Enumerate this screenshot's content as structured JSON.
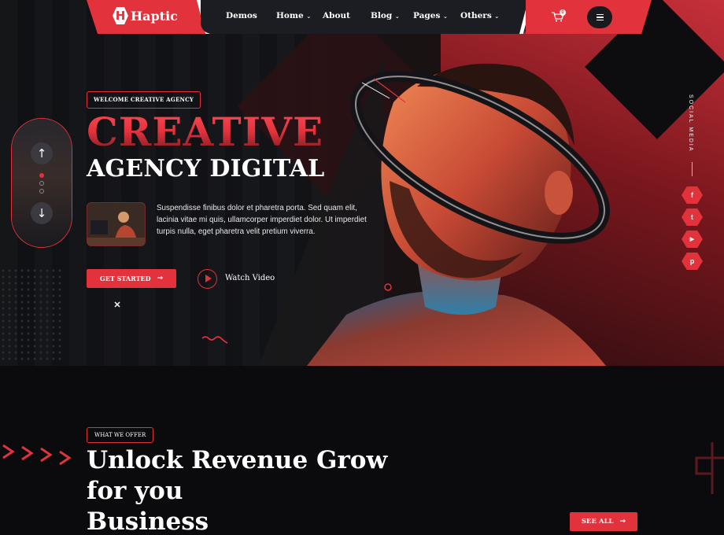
{
  "brand": {
    "name": "Haptic",
    "mark": "H",
    "accent": "#e2323c"
  },
  "nav": {
    "items": [
      {
        "label": "Demos"
      },
      {
        "label": "Home"
      },
      {
        "label": "About"
      },
      {
        "label": "Blog"
      },
      {
        "label": "Pages"
      },
      {
        "label": "Others"
      }
    ],
    "cart_count": "0"
  },
  "hero": {
    "badge": "WELCOME CREATIVE AGENCY",
    "title_1": "CREATIVE",
    "title_2": "AGENCY DIGITAL",
    "paragraph": "Suspendisse finibus dolor et pharetra porta. Sed quam elit, lacinia vitae mi quis, ullamcorper imperdiet dolor. Ut imperdiet turpis nulla, eget pharetra velit pretium viverra.",
    "cta_label": "GET STARTED",
    "video_label": "Watch Video"
  },
  "social": {
    "label": "SOCIAL MEDIA",
    "items": [
      {
        "icon": "facebook-icon",
        "glyph": "f"
      },
      {
        "icon": "twitter-icon",
        "glyph": "t"
      },
      {
        "icon": "youtube-icon",
        "glyph": "▶"
      },
      {
        "icon": "pinterest-icon",
        "glyph": "p"
      }
    ]
  },
  "offer": {
    "badge": "WHAT WE OFFER",
    "heading_line_1": "Unlock Revenue Grow",
    "heading_line_2": "for you",
    "heading_line_3": "Business",
    "see_all": "SEE ALL"
  }
}
